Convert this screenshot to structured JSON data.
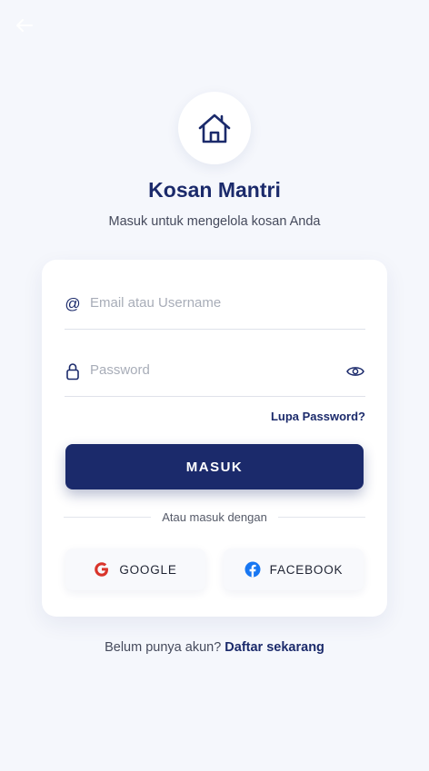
{
  "app": {
    "title": "Kosan Mantri",
    "subtitle": "Masuk untuk mengelola kosan Anda"
  },
  "login_form": {
    "email_placeholder": "Email atau Username",
    "password_placeholder": "Password",
    "forgot_password": "Lupa Password?",
    "submit_label": "MASUK"
  },
  "social": {
    "divider_text": "Atau masuk dengan",
    "google_label": "GOOGLE",
    "facebook_label": "FACEBOOK"
  },
  "signup": {
    "prompt": "Belum punya akun?",
    "link": "Daftar sekarang"
  },
  "icons": {
    "back": "arrow-left-icon",
    "logo": "house-icon",
    "email": "at-sign-icon",
    "password": "lock-icon",
    "toggle": "eye-icon",
    "google": "google-logo-icon",
    "facebook": "facebook-logo-icon"
  },
  "colors": {
    "primary": "#1b2a6b",
    "background": "#f5f7fc",
    "google": "#d9342b",
    "facebook": "#1877f2"
  }
}
